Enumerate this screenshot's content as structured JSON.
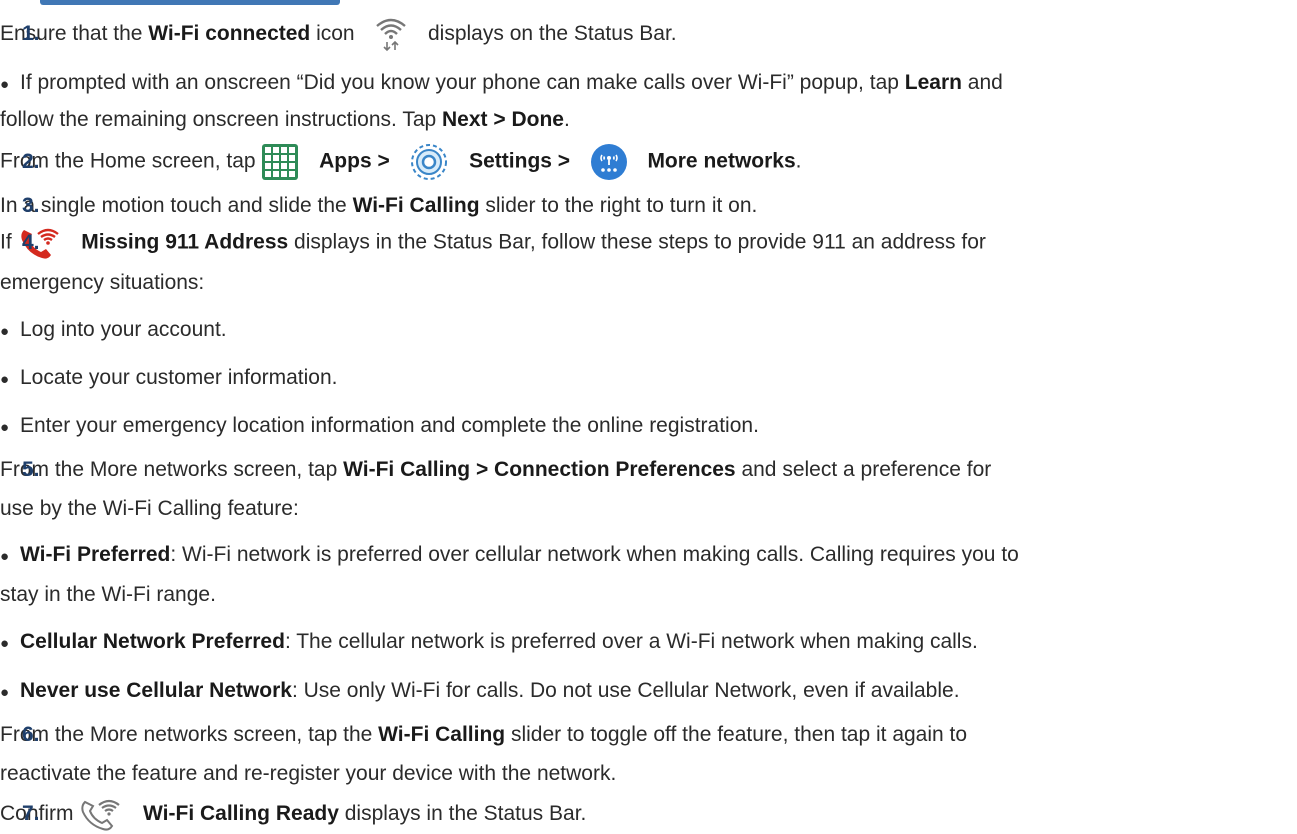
{
  "steps": [
    {
      "n": "1.",
      "pre": "Ensure that the ",
      "bold": "Wi-Fi connected",
      "post": " icon",
      "post2": " displays on the Status Bar."
    },
    {
      "n": "2.",
      "pre": "From the Home screen, tap ",
      "apps": "Apps >",
      "settings": "Settings >",
      "more": "More networks",
      "end": "."
    },
    {
      "n": "3.",
      "pre": "In a single motion touch and slide the ",
      "bold": "Wi-Fi Calling",
      "post": " slider to the right to turn it on."
    },
    {
      "n": "4.",
      "pre": "If ",
      "bold": "Missing 911 Address",
      "post": " displays in the Status Bar, follow these steps to provide 911 an address for",
      "cont": "emergency situations:"
    },
    {
      "n": "5.",
      "pre": "From the More networks screen, tap ",
      "bold": "Wi-Fi Calling > Connection Preferences",
      "post": " and select a preference for",
      "cont": "use by the Wi-Fi Calling feature:"
    },
    {
      "n": "6.",
      "pre": "From the More networks screen, tap the ",
      "bold": "Wi-Fi Calling",
      "post": " slider to toggle off the feature, then tap it again to",
      "cont": "reactivate the feature and re-register your device with the network."
    },
    {
      "n": "7.",
      "pre": "Confirm ",
      "bold": "Wi-Fi Calling Ready",
      "post": " displays in the Status Bar."
    }
  ],
  "sub1": {
    "pre": "If prompted with an onscreen “Did you know your phone can make calls over Wi-Fi” popup, tap ",
    "bold": "Learn",
    "post": " and",
    "cont": "follow the remaining onscreen instructions. Tap ",
    "bold2": "Next > Done",
    "end": "."
  },
  "sub4": [
    "Log into your account.",
    "Locate your customer information.",
    "Enter your emergency location information and complete the online registration."
  ],
  "sub5": [
    {
      "bold": "Wi-Fi Preferred",
      "text": ": Wi-Fi network is preferred over cellular network when making calls. Calling requires you to",
      "cont": "stay in the Wi-Fi range."
    },
    {
      "bold": "Cellular Network Preferred",
      "text": ": The cellular network is preferred over a Wi-Fi network when making calls."
    },
    {
      "bold": "Never use Cellular Network",
      "text": ": Use only Wi-Fi for calls. Do not use Cellular Network, even if available."
    }
  ],
  "bullet": "●",
  "colors": {
    "phone_red": "#d42a1f",
    "grid_green": "#2e8b57",
    "settings_blue": "#3a86c8",
    "network_blue": "#2f7dd3"
  }
}
